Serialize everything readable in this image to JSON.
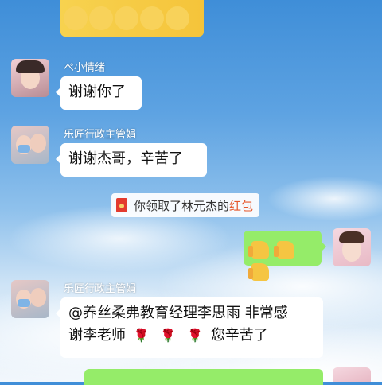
{
  "messages": [
    {
      "sender": "ぺ小情绪",
      "text": "谢谢你了"
    },
    {
      "sender": "乐匠行政主管娟",
      "text": "谢谢杰哥，辛苦了"
    },
    {
      "sender": "乐匠行政主管娟",
      "text_line1": "@养丝柔弗教育经理李思雨  非常感",
      "text_line2_a": "谢李老师",
      "text_line2_b": "您辛苦了"
    }
  ],
  "system_notice": {
    "prefix": "你领取了林元杰的",
    "highlight": "红包"
  },
  "icons": {
    "top_sticker": "yellow-character-sticker-icon",
    "red_packet": "red-packet-icon",
    "thumbs_up": "thumbs-up-icon",
    "rose": "rose-icon"
  },
  "colors": {
    "sent_bubble": "#95ec69",
    "received_bubble": "#ffffff",
    "highlight": "#e6572b"
  }
}
